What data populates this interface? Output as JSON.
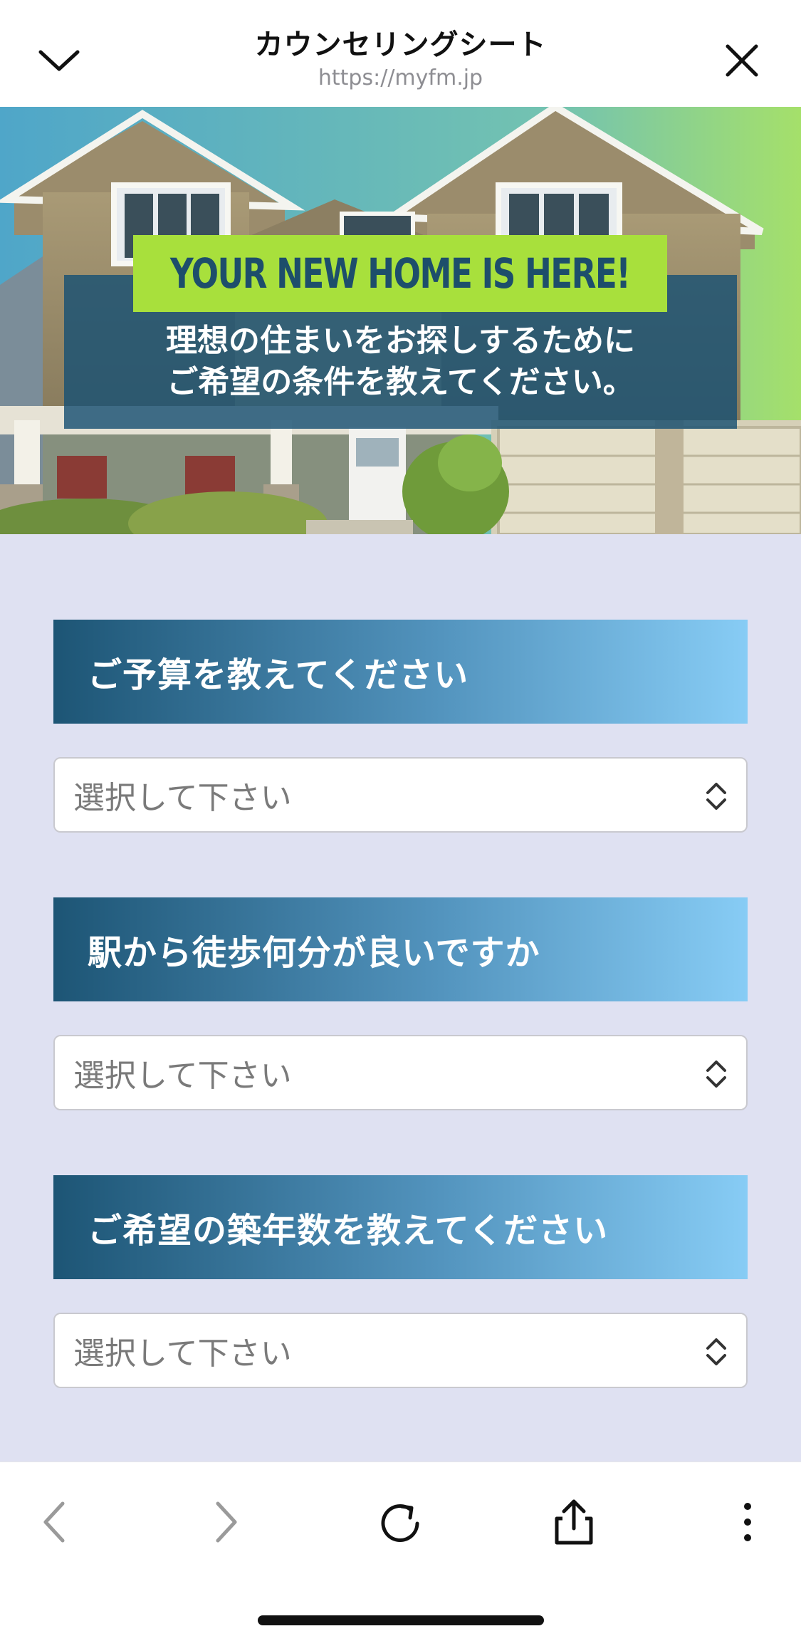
{
  "browser": {
    "title": "カウンセリングシート",
    "url": "https://myfm.jp",
    "collapse_icon": "chevron-down-icon",
    "close_icon": "close-icon"
  },
  "hero": {
    "headline": "YOUR NEW HOME IS HERE!",
    "line1": "理想の住まいをお探しするために",
    "line2": "ご希望の条件を教えてください。"
  },
  "form": {
    "questions": [
      {
        "label": "ご予算を教えてください",
        "selected": "選択して下さい"
      },
      {
        "label": "駅から徒歩何分が良いですか",
        "selected": "選択して下さい"
      },
      {
        "label": "ご希望の築年数を教えてください",
        "selected": "選択して下さい"
      }
    ]
  },
  "toolbar": {
    "icons": [
      "back-icon",
      "forward-icon",
      "reload-icon",
      "share-icon",
      "more-icon"
    ]
  },
  "colors": {
    "page_bg": "#dfe1f2",
    "header_gradient_start": "#1d5575",
    "header_gradient_end": "#87ccf5",
    "accent_green": "#a8e03c"
  }
}
